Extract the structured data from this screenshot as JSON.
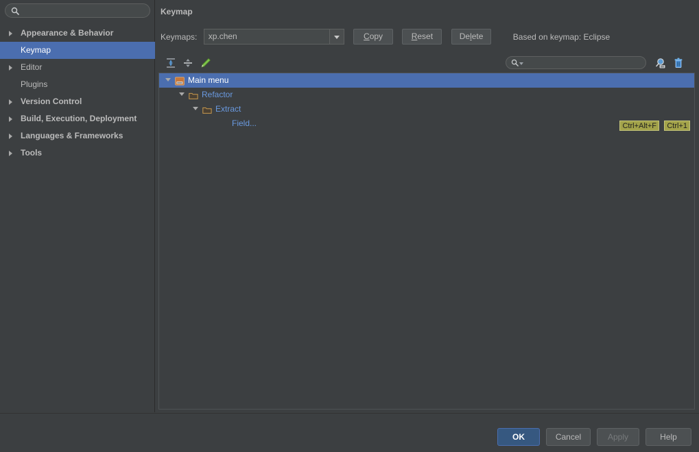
{
  "sidebar": {
    "search": {
      "value": "",
      "placeholder": "",
      "icon": "search-icon"
    },
    "items": [
      {
        "label": "Appearance & Behavior",
        "expandable": true,
        "selected": false
      },
      {
        "label": "Keymap",
        "expandable": false,
        "selected": true
      },
      {
        "label": "Editor",
        "expandable": true,
        "selected": false
      },
      {
        "label": "Plugins",
        "expandable": false,
        "selected": false
      },
      {
        "label": "Version Control",
        "expandable": true,
        "selected": false
      },
      {
        "label": "Build, Execution, Deployment",
        "expandable": true,
        "selected": false
      },
      {
        "label": "Languages & Frameworks",
        "expandable": true,
        "selected": false
      },
      {
        "label": "Tools",
        "expandable": true,
        "selected": false
      }
    ]
  },
  "main": {
    "title": "Keymap",
    "keymaps_label": "Keymaps:",
    "keymap_selected": "xp.chen",
    "buttons": {
      "copy": "Copy",
      "reset": "Reset",
      "delete": "Delete"
    },
    "based_on": "Based on keymap: Eclipse",
    "toolbar": {
      "expand_all": "expand-all-icon",
      "collapse_all": "collapse-all-icon",
      "edit": "edit-pencil-icon",
      "find_shortcut": "find-by-shortcut-icon",
      "clear": "trash-icon"
    },
    "tree_search": {
      "value": "",
      "placeholder": ""
    },
    "tree": [
      {
        "label": "Main menu",
        "level": 0,
        "expanded": true,
        "selected": true,
        "icon": "main-menu-icon",
        "shortcuts": []
      },
      {
        "label": "Refactor",
        "level": 1,
        "expanded": true,
        "selected": false,
        "icon": "folder-icon",
        "shortcuts": []
      },
      {
        "label": "Extract",
        "level": 2,
        "expanded": true,
        "selected": false,
        "icon": "folder-icon",
        "shortcuts": []
      },
      {
        "label": "Field...",
        "level": 3,
        "expanded": false,
        "selected": false,
        "icon": "none",
        "shortcuts": [
          "Ctrl+Alt+F",
          "Ctrl+1"
        ]
      }
    ]
  },
  "footer": {
    "ok": "OK",
    "cancel": "Cancel",
    "apply": "Apply",
    "help": "Help"
  },
  "colors": {
    "background": "#3c3f41",
    "selection": "#4b6eaf",
    "link": "#6a9ae0",
    "shortcut_badge": "#a3a34a",
    "primary_button": "#365880"
  }
}
